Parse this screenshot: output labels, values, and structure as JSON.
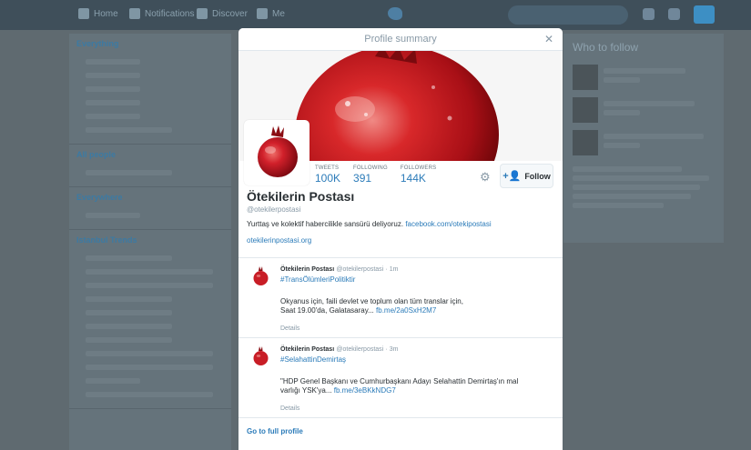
{
  "colors": {
    "accent": "#2b7bb9",
    "overlay": "#5f6a70",
    "modal_bg": "#ffffff"
  },
  "background": {
    "nav": [
      "Home",
      "Notifications",
      "Discover",
      "Me"
    ],
    "left_sections": [
      "Everything",
      "All people",
      "Everywhere",
      "Istanbul Trends"
    ],
    "right_title": "Who to follow"
  },
  "modal": {
    "title": "Profile summary",
    "close_icon": "close-icon"
  },
  "profile": {
    "stats": [
      {
        "label": "TWEETS",
        "value": "100K"
      },
      {
        "label": "FOLLOWING",
        "value": "391"
      },
      {
        "label": "FOLLOWERS",
        "value": "144K"
      }
    ],
    "follow_label": "Follow",
    "name": "Ötekilerin Postası",
    "handle": "@otekilerpostasi",
    "bio_text": "Yurttaş ve kolektif habercilikle sansürü deliyoruz.",
    "bio_link": "facebook.com/otekipostasi",
    "website": "otekilerinpostasi.org"
  },
  "tweets": [
    {
      "author": "Ötekilerin Postası",
      "handle": "@otekilerpostasi",
      "time": "1m",
      "hashtag": "#TransÖlümleriPolitiktir",
      "text_line1": "Okyanus için, faili devlet ve toplum olan tüm translar için,",
      "text_line2": "Saat 19.00'da, Galatasaray...",
      "link": "fb.me/2a0SxH2M7",
      "details": "Details"
    },
    {
      "author": "Ötekilerin Postası",
      "handle": "@otekilerpostasi",
      "time": "3m",
      "hashtag": "#SelahattinDemirtaş",
      "text_line1": "\"HDP Genel Başkanı ve Cumhurbaşkanı Adayı Selahattin Demirtaş'ın mal",
      "text_line2": "varlığı YSK'ya...",
      "link": "fb.me/3eBKkNDG7",
      "details": "Details"
    }
  ],
  "footer_link": "Go to full profile"
}
